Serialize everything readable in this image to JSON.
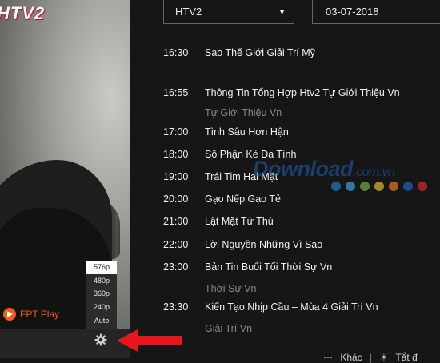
{
  "video": {
    "channel_logo": "HTV2",
    "brand_label": "FPT Play",
    "quality_options": [
      "576p",
      "480p",
      "360p",
      "240p",
      "Auto"
    ],
    "selected_quality": "576p"
  },
  "schedule": {
    "channel_select": "HTV2",
    "date": "03-07-2018",
    "programs": [
      {
        "time": "16:30",
        "title": "Sao Thế Giới Giải Trí Mỹ",
        "subtitle": ""
      },
      {
        "time": "16:55",
        "title": "Thông Tin Tổng Hợp Htv2 Tự Giới Thiệu Vn",
        "subtitle": "Tự Giới Thiệu Vn"
      },
      {
        "time": "17:00",
        "title": "Tình Sâu Hơn Hận",
        "subtitle": ""
      },
      {
        "time": "18:00",
        "title": "Số Phận Kẻ Đa Tình",
        "subtitle": ""
      },
      {
        "time": "19:00",
        "title": "Trái Tim Hai Mặt",
        "subtitle": ""
      },
      {
        "time": "20:00",
        "title": "Gạo Nếp Gạo Tẻ",
        "subtitle": ""
      },
      {
        "time": "21:00",
        "title": "Lật Mặt Tử Thù",
        "subtitle": ""
      },
      {
        "time": "22:00",
        "title": "Lời Nguyền Những Vì Sao",
        "subtitle": ""
      },
      {
        "time": "23:00",
        "title": "Bản Tin Buổi Tối Thời Sự Vn",
        "subtitle": "Thời Sự Vn"
      },
      {
        "time": "23:30",
        "title": "Kiến Tạo Nhịp Cầu – Mùa 4 Giải Trí Vn",
        "subtitle": "Giải Trí Vn"
      }
    ]
  },
  "watermark": {
    "text": "Download",
    "domain": ".com.vn"
  },
  "dot_colors": [
    "#1f6fb5",
    "#3a8fd0",
    "#6a9a3a",
    "#c9a52a",
    "#d56a1f",
    "#1a5aa8",
    "#c0262d"
  ],
  "bottom_bar": {
    "left_text": "Khác",
    "right_text": "Tắt đ"
  },
  "colors": {
    "brand": "#f25a1d",
    "arrow": "#e8171f",
    "selected_quality_bg": "#ffffff"
  }
}
